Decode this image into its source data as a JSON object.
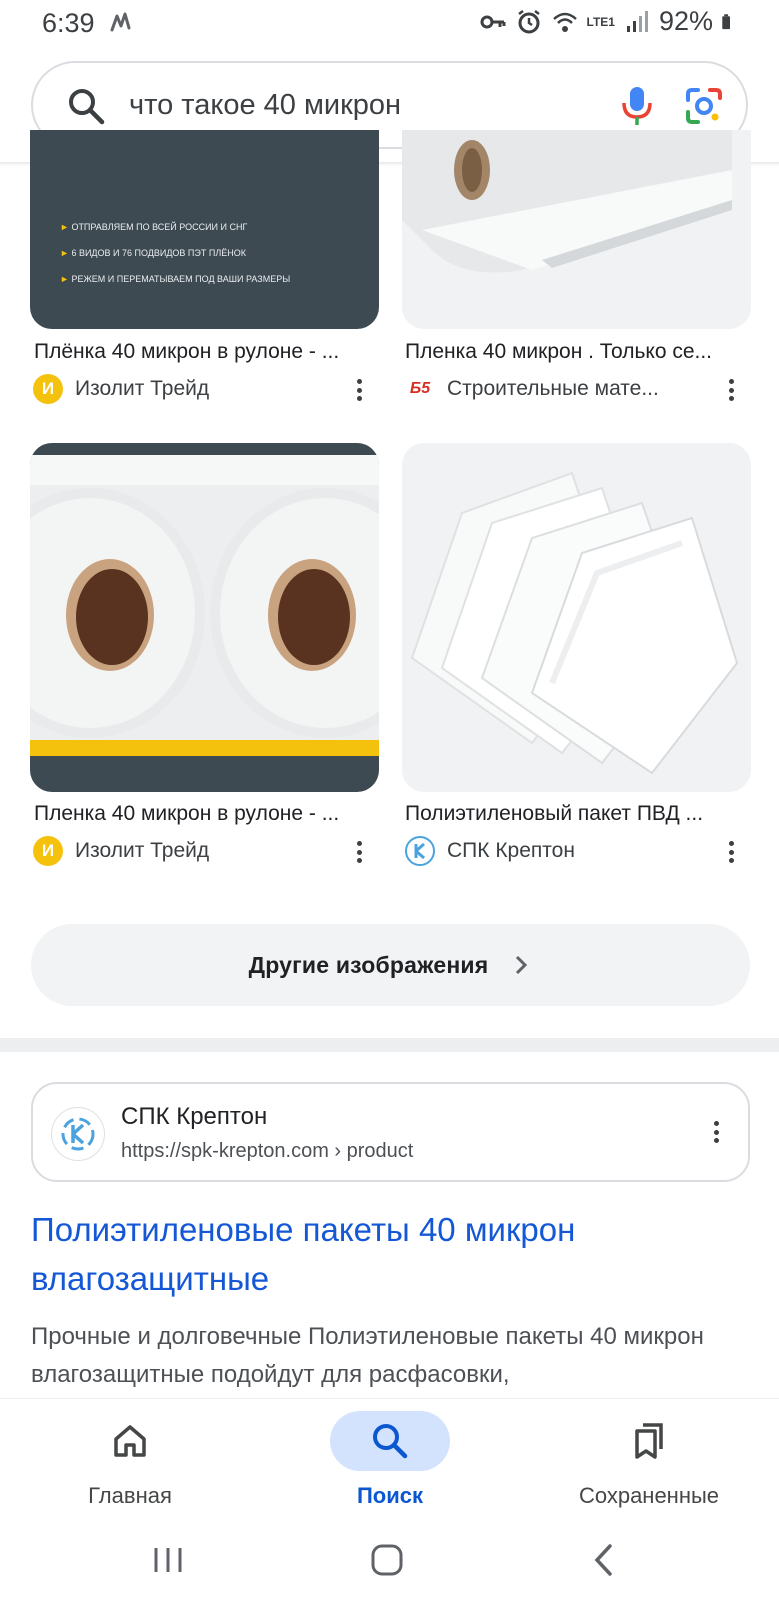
{
  "status_bar": {
    "time": "6:39",
    "battery": "92%",
    "network_label": "LTE1"
  },
  "search": {
    "query": "что такое 40 микрон"
  },
  "images": [
    {
      "title": "Плёнка 40 микрон в рулоне - ...",
      "source": "Изолит Трейд",
      "source_logo_text": "И",
      "overlay_lines": [
        "ОТПРАВЛЯЕМ ПО ВСЕЙ РОССИИ И СНГ",
        "6 ВИДОВ И 76 ПОДВИДОВ ПЭТ ПЛЁНОК",
        "РЕЖЕМ И ПЕРЕМАТЫВАЕМ ПОД ВАШИ РАЗМЕРЫ"
      ]
    },
    {
      "title": "Пленка 40 микрон . Только се...",
      "source": "Строительные мате...",
      "source_logo_text": "Б5"
    },
    {
      "title": "Пленка 40 микрон в рулоне - ...",
      "source": "Изолит Трейд",
      "source_logo_text": "И"
    },
    {
      "title": "Полиэтиленовый пакет ПВД ...",
      "source": "СПК Крептон",
      "source_logo_text": "K"
    }
  ],
  "more_images": {
    "label": "Другие изображения"
  },
  "result": {
    "site_name": "СПК Крептон",
    "url": "https://spk-krepton.com",
    "url_crumb": " › product",
    "title": "Полиэтиленовые пакеты 40 микрон влагозащитные",
    "snippet": "Прочные и долговечные Полиэтиленовые пакеты 40 микрон влагозащитные подойдут для расфасовки,"
  },
  "bottom_nav": [
    {
      "label": "Главная",
      "icon": "home-icon",
      "active": false
    },
    {
      "label": "Поиск",
      "icon": "search-icon",
      "active": true
    },
    {
      "label": "Сохраненные",
      "icon": "collections-icon",
      "active": false
    }
  ],
  "colors": {
    "link_blue": "#1558d6",
    "active_nav": "#0b57d0",
    "active_pill": "#d3e3fd",
    "izolit_logo": "#f4c20d",
    "thumb_dark": "#3d4a52"
  }
}
